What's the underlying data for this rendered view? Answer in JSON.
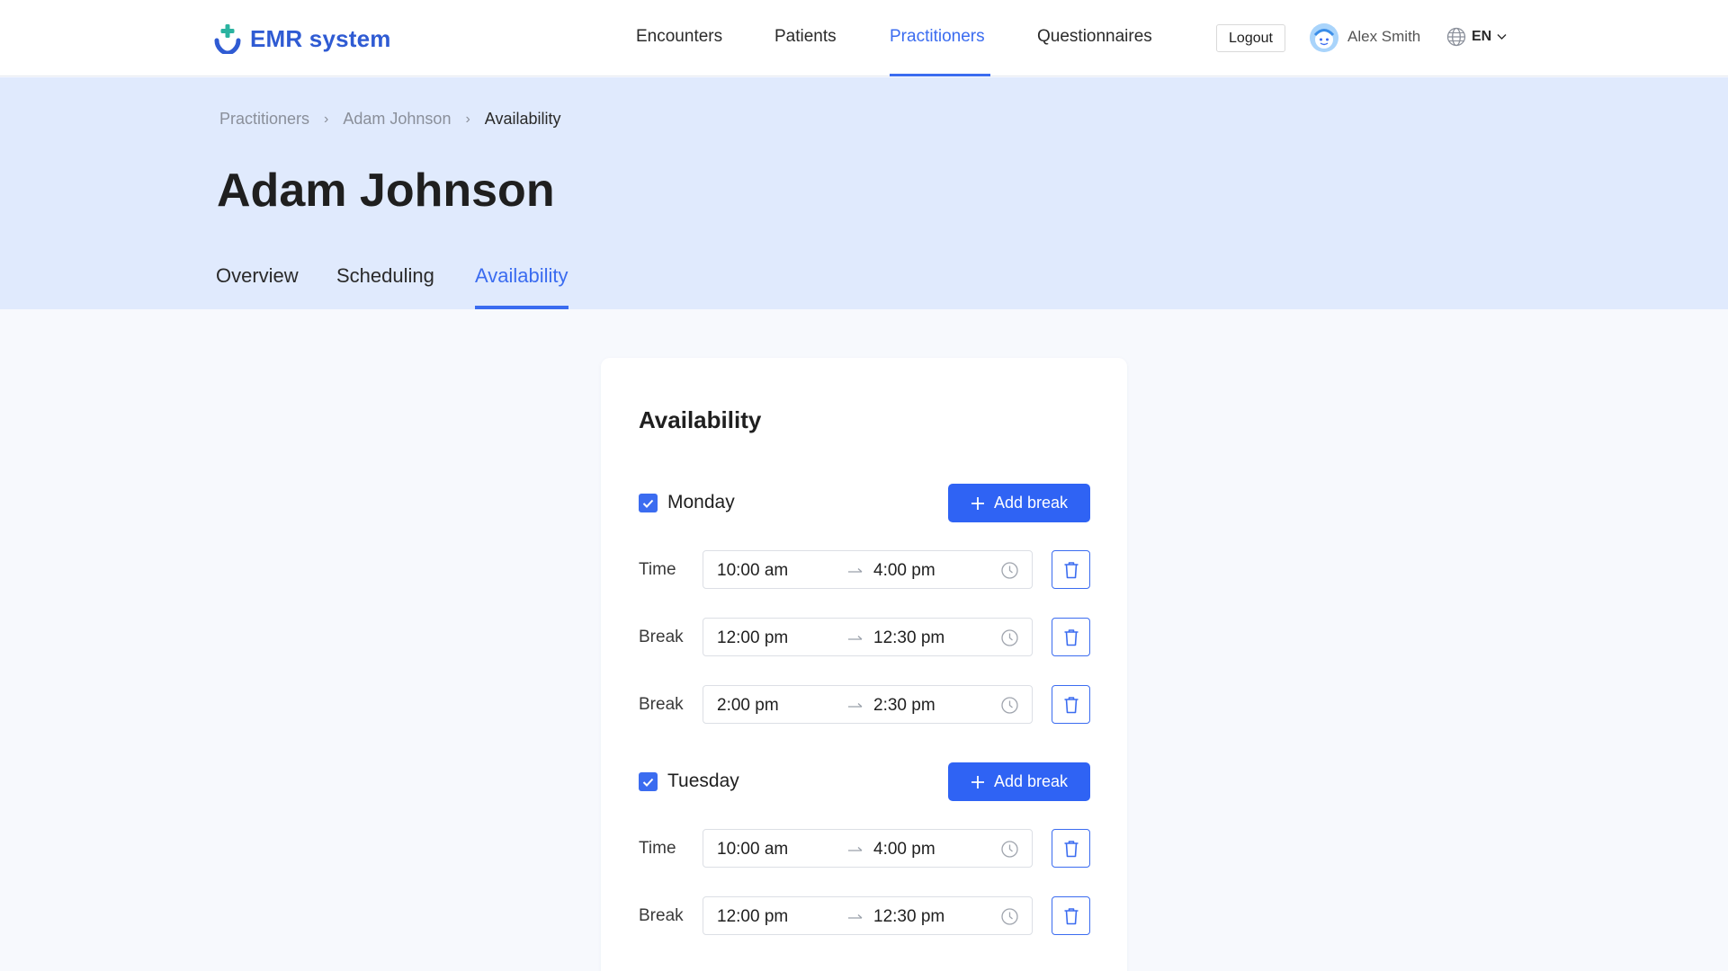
{
  "header": {
    "app_name": "EMR system",
    "nav": [
      {
        "label": "Encounters",
        "active": false
      },
      {
        "label": "Patients",
        "active": false
      },
      {
        "label": "Practitioners",
        "active": true
      },
      {
        "label": "Questionnaires",
        "active": false
      }
    ],
    "logout_label": "Logout",
    "user_name": "Alex Smith",
    "language": "EN"
  },
  "breadcrumb": [
    "Practitioners",
    "Adam Johnson",
    "Availability"
  ],
  "page_title": "Adam Johnson",
  "tabs": [
    {
      "label": "Overview",
      "active": false
    },
    {
      "label": "Scheduling",
      "active": false
    },
    {
      "label": "Availability",
      "active": true
    }
  ],
  "availability": {
    "title": "Availability",
    "add_break_label": "Add break",
    "days": [
      {
        "day": "Monday",
        "checked": true,
        "slots": [
          {
            "label": "Time",
            "start": "10:00 am",
            "end": "4:00 pm"
          },
          {
            "label": "Break",
            "start": "12:00 pm",
            "end": "12:30 pm"
          },
          {
            "label": "Break",
            "start": "2:00 pm",
            "end": "2:30 pm"
          }
        ]
      },
      {
        "day": "Tuesday",
        "checked": true,
        "slots": [
          {
            "label": "Time",
            "start": "10:00 am",
            "end": "4:00 pm"
          },
          {
            "label": "Break",
            "start": "12:00 pm",
            "end": "12:30 pm"
          }
        ]
      }
    ]
  },
  "colors": {
    "accent": "#3b6cf0",
    "brand": "#2f5bd3",
    "hero_bg": "#e0eafd",
    "button_bg": "#2f63f4",
    "page_bg": "#f7f9fd"
  },
  "icons": {
    "logo": "plus-smile-logo-icon",
    "avatar": "user-avatar-icon",
    "language": "globe-icon",
    "dropdown": "chevron-down-icon",
    "checkbox": "checkmark-icon",
    "add": "plus-icon",
    "range_separator": "arrow-right-icon",
    "time": "clock-icon",
    "delete": "trash-icon"
  }
}
